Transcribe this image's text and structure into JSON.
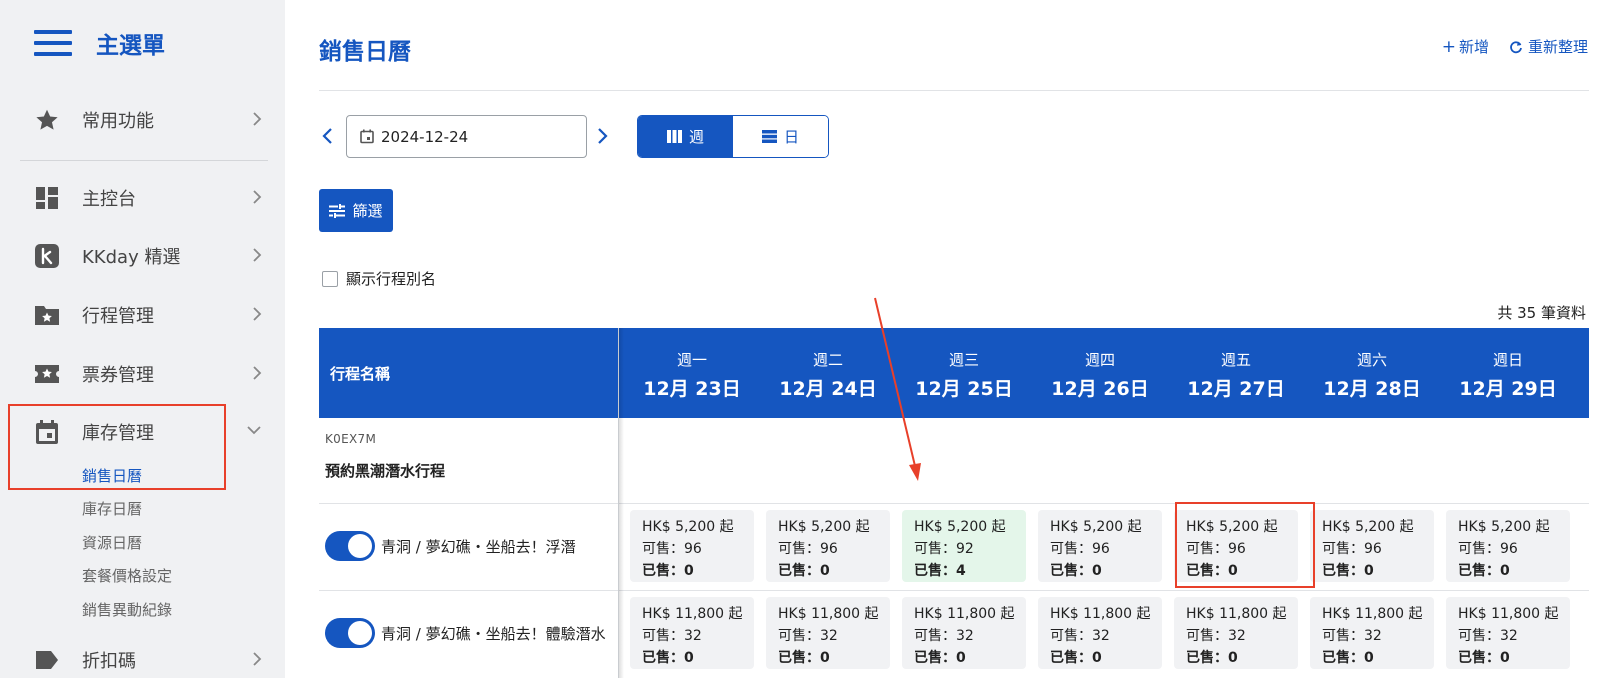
{
  "sidebar": {
    "title": "主選單",
    "items": [
      {
        "label": "常用功能",
        "icon": "star-icon"
      },
      {
        "label": "主控台",
        "icon": "dashboard-icon"
      },
      {
        "label": "KKday 精選",
        "icon": "kkday-logo-icon"
      },
      {
        "label": "行程管理",
        "icon": "folder-star-icon"
      },
      {
        "label": "票券管理",
        "icon": "ticket-star-icon"
      },
      {
        "label": "庫存管理",
        "icon": "calendar-icon"
      },
      {
        "label": "折扣碼",
        "icon": "tag-icon"
      }
    ],
    "submenu": [
      "銷售日曆",
      "庫存日曆",
      "資源日曆",
      "套餐價格設定",
      "銷售異動紀錄"
    ],
    "active_submenu": "銷售日曆"
  },
  "header": {
    "title": "銷售日曆",
    "add_label": "新增",
    "refresh_label": "重新整理"
  },
  "toolbar": {
    "date_value": "2024-12-24",
    "view_week": "週",
    "view_day": "日",
    "active_view": "週",
    "filter_label": "篩選",
    "show_alias_label": "顯示行程別名",
    "show_alias_checked": false
  },
  "result_count": "共 35 筆資料",
  "table": {
    "name_header": "行程名稱",
    "days": [
      {
        "weekday": "週一",
        "date": "12月 23日"
      },
      {
        "weekday": "週二",
        "date": "12月 24日"
      },
      {
        "weekday": "週三",
        "date": "12月 25日"
      },
      {
        "weekday": "週四",
        "date": "12月 26日"
      },
      {
        "weekday": "週五",
        "date": "12月 27日"
      },
      {
        "weekday": "週六",
        "date": "12月 28日"
      },
      {
        "weekday": "週日",
        "date": "12月 29日"
      }
    ],
    "product": {
      "code": "K0EX7M",
      "name": "預約黑潮潛水行程"
    },
    "packages": [
      {
        "name": "青洞 / 夢幻礁・坐船去！浮潛",
        "enabled": true,
        "cells": [
          {
            "price": "HK$ 5,200 起",
            "avail": "可售：96",
            "sold": "已售：0"
          },
          {
            "price": "HK$ 5,200 起",
            "avail": "可售：96",
            "sold": "已售：0"
          },
          {
            "price": "HK$ 5,200 起",
            "avail": "可售：92",
            "sold": "已售：4"
          },
          {
            "price": "HK$ 5,200 起",
            "avail": "可售：96",
            "sold": "已售：0"
          },
          {
            "price": "HK$ 5,200 起",
            "avail": "可售：96",
            "sold": "已售：0"
          },
          {
            "price": "HK$ 5,200 起",
            "avail": "可售：96",
            "sold": "已售：0"
          },
          {
            "price": "HK$ 5,200 起",
            "avail": "可售：96",
            "sold": "已售：0"
          }
        ]
      },
      {
        "name": "青洞 / 夢幻礁・坐船去！體驗潛水",
        "enabled": true,
        "cells": [
          {
            "price": "HK$ 11,800 起",
            "avail": "可售：32",
            "sold": "已售：0"
          },
          {
            "price": "HK$ 11,800 起",
            "avail": "可售：32",
            "sold": "已售：0"
          },
          {
            "price": "HK$ 11,800 起",
            "avail": "可售：32",
            "sold": "已售：0"
          },
          {
            "price": "HK$ 11,800 起",
            "avail": "可售：32",
            "sold": "已售：0"
          },
          {
            "price": "HK$ 11,800 起",
            "avail": "可售：32",
            "sold": "已售：0"
          },
          {
            "price": "HK$ 11,800 起",
            "avail": "可售：32",
            "sold": "已售：0"
          },
          {
            "price": "HK$ 11,800 起",
            "avail": "可售：32",
            "sold": "已售：0"
          }
        ]
      }
    ]
  },
  "colors": {
    "primary": "#1556c0",
    "annotation": "#e8402a",
    "highlight_cell": "#e4f6ea",
    "sidebar_bg": "#f0f1f3"
  }
}
